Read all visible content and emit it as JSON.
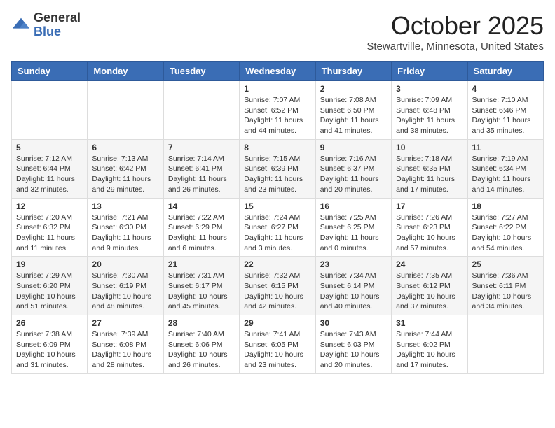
{
  "logo": {
    "general": "General",
    "blue": "Blue"
  },
  "header": {
    "month": "October 2025",
    "location": "Stewartville, Minnesota, United States"
  },
  "weekdays": [
    "Sunday",
    "Monday",
    "Tuesday",
    "Wednesday",
    "Thursday",
    "Friday",
    "Saturday"
  ],
  "weeks": [
    [
      {
        "day": "",
        "sunrise": "",
        "sunset": "",
        "daylight": ""
      },
      {
        "day": "",
        "sunrise": "",
        "sunset": "",
        "daylight": ""
      },
      {
        "day": "",
        "sunrise": "",
        "sunset": "",
        "daylight": ""
      },
      {
        "day": "1",
        "sunrise": "Sunrise: 7:07 AM",
        "sunset": "Sunset: 6:52 PM",
        "daylight": "Daylight: 11 hours and 44 minutes."
      },
      {
        "day": "2",
        "sunrise": "Sunrise: 7:08 AM",
        "sunset": "Sunset: 6:50 PM",
        "daylight": "Daylight: 11 hours and 41 minutes."
      },
      {
        "day": "3",
        "sunrise": "Sunrise: 7:09 AM",
        "sunset": "Sunset: 6:48 PM",
        "daylight": "Daylight: 11 hours and 38 minutes."
      },
      {
        "day": "4",
        "sunrise": "Sunrise: 7:10 AM",
        "sunset": "Sunset: 6:46 PM",
        "daylight": "Daylight: 11 hours and 35 minutes."
      }
    ],
    [
      {
        "day": "5",
        "sunrise": "Sunrise: 7:12 AM",
        "sunset": "Sunset: 6:44 PM",
        "daylight": "Daylight: 11 hours and 32 minutes."
      },
      {
        "day": "6",
        "sunrise": "Sunrise: 7:13 AM",
        "sunset": "Sunset: 6:42 PM",
        "daylight": "Daylight: 11 hours and 29 minutes."
      },
      {
        "day": "7",
        "sunrise": "Sunrise: 7:14 AM",
        "sunset": "Sunset: 6:41 PM",
        "daylight": "Daylight: 11 hours and 26 minutes."
      },
      {
        "day": "8",
        "sunrise": "Sunrise: 7:15 AM",
        "sunset": "Sunset: 6:39 PM",
        "daylight": "Daylight: 11 hours and 23 minutes."
      },
      {
        "day": "9",
        "sunrise": "Sunrise: 7:16 AM",
        "sunset": "Sunset: 6:37 PM",
        "daylight": "Daylight: 11 hours and 20 minutes."
      },
      {
        "day": "10",
        "sunrise": "Sunrise: 7:18 AM",
        "sunset": "Sunset: 6:35 PM",
        "daylight": "Daylight: 11 hours and 17 minutes."
      },
      {
        "day": "11",
        "sunrise": "Sunrise: 7:19 AM",
        "sunset": "Sunset: 6:34 PM",
        "daylight": "Daylight: 11 hours and 14 minutes."
      }
    ],
    [
      {
        "day": "12",
        "sunrise": "Sunrise: 7:20 AM",
        "sunset": "Sunset: 6:32 PM",
        "daylight": "Daylight: 11 hours and 11 minutes."
      },
      {
        "day": "13",
        "sunrise": "Sunrise: 7:21 AM",
        "sunset": "Sunset: 6:30 PM",
        "daylight": "Daylight: 11 hours and 9 minutes."
      },
      {
        "day": "14",
        "sunrise": "Sunrise: 7:22 AM",
        "sunset": "Sunset: 6:29 PM",
        "daylight": "Daylight: 11 hours and 6 minutes."
      },
      {
        "day": "15",
        "sunrise": "Sunrise: 7:24 AM",
        "sunset": "Sunset: 6:27 PM",
        "daylight": "Daylight: 11 hours and 3 minutes."
      },
      {
        "day": "16",
        "sunrise": "Sunrise: 7:25 AM",
        "sunset": "Sunset: 6:25 PM",
        "daylight": "Daylight: 11 hours and 0 minutes."
      },
      {
        "day": "17",
        "sunrise": "Sunrise: 7:26 AM",
        "sunset": "Sunset: 6:23 PM",
        "daylight": "Daylight: 10 hours and 57 minutes."
      },
      {
        "day": "18",
        "sunrise": "Sunrise: 7:27 AM",
        "sunset": "Sunset: 6:22 PM",
        "daylight": "Daylight: 10 hours and 54 minutes."
      }
    ],
    [
      {
        "day": "19",
        "sunrise": "Sunrise: 7:29 AM",
        "sunset": "Sunset: 6:20 PM",
        "daylight": "Daylight: 10 hours and 51 minutes."
      },
      {
        "day": "20",
        "sunrise": "Sunrise: 7:30 AM",
        "sunset": "Sunset: 6:19 PM",
        "daylight": "Daylight: 10 hours and 48 minutes."
      },
      {
        "day": "21",
        "sunrise": "Sunrise: 7:31 AM",
        "sunset": "Sunset: 6:17 PM",
        "daylight": "Daylight: 10 hours and 45 minutes."
      },
      {
        "day": "22",
        "sunrise": "Sunrise: 7:32 AM",
        "sunset": "Sunset: 6:15 PM",
        "daylight": "Daylight: 10 hours and 42 minutes."
      },
      {
        "day": "23",
        "sunrise": "Sunrise: 7:34 AM",
        "sunset": "Sunset: 6:14 PM",
        "daylight": "Daylight: 10 hours and 40 minutes."
      },
      {
        "day": "24",
        "sunrise": "Sunrise: 7:35 AM",
        "sunset": "Sunset: 6:12 PM",
        "daylight": "Daylight: 10 hours and 37 minutes."
      },
      {
        "day": "25",
        "sunrise": "Sunrise: 7:36 AM",
        "sunset": "Sunset: 6:11 PM",
        "daylight": "Daylight: 10 hours and 34 minutes."
      }
    ],
    [
      {
        "day": "26",
        "sunrise": "Sunrise: 7:38 AM",
        "sunset": "Sunset: 6:09 PM",
        "daylight": "Daylight: 10 hours and 31 minutes."
      },
      {
        "day": "27",
        "sunrise": "Sunrise: 7:39 AM",
        "sunset": "Sunset: 6:08 PM",
        "daylight": "Daylight: 10 hours and 28 minutes."
      },
      {
        "day": "28",
        "sunrise": "Sunrise: 7:40 AM",
        "sunset": "Sunset: 6:06 PM",
        "daylight": "Daylight: 10 hours and 26 minutes."
      },
      {
        "day": "29",
        "sunrise": "Sunrise: 7:41 AM",
        "sunset": "Sunset: 6:05 PM",
        "daylight": "Daylight: 10 hours and 23 minutes."
      },
      {
        "day": "30",
        "sunrise": "Sunrise: 7:43 AM",
        "sunset": "Sunset: 6:03 PM",
        "daylight": "Daylight: 10 hours and 20 minutes."
      },
      {
        "day": "31",
        "sunrise": "Sunrise: 7:44 AM",
        "sunset": "Sunset: 6:02 PM",
        "daylight": "Daylight: 10 hours and 17 minutes."
      },
      {
        "day": "",
        "sunrise": "",
        "sunset": "",
        "daylight": ""
      }
    ]
  ]
}
